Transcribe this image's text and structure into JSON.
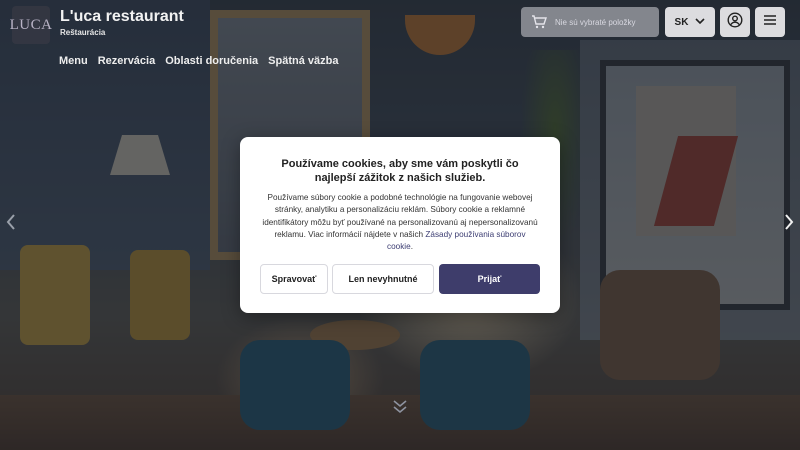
{
  "brand": {
    "logo_text": "LUCA",
    "title": "L'uca restaurant",
    "subtitle": "Reštaurácia"
  },
  "nav": {
    "items": [
      {
        "label": "Menu"
      },
      {
        "label": "Rezervácia"
      },
      {
        "label": "Oblasti doručenia"
      },
      {
        "label": "Spätná väzba"
      }
    ]
  },
  "header_actions": {
    "cart_text": "Nie sú vybraté položky",
    "language": "SK"
  },
  "cookie_dialog": {
    "title": "Používame cookies, aby sme vám poskytli čo najlepší zážitok z našich služieb.",
    "body": "Používame súbory cookie a podobné technológie na fungovanie webovej stránky, analytiku a personalizáciu reklám. Súbory cookie a reklamné identifikátory môžu byť používané na personalizovanú aj nepersonalizovanú reklamu. Viac informácií nájdete v našich",
    "link_text": "Zásady používania súborov cookie",
    "body_end": ".",
    "buttons": {
      "manage": "Spravovať",
      "necessary": "Len nevyhnutné",
      "accept": "Prijať"
    },
    "colors": {
      "accent": "#3e3d6b"
    }
  }
}
